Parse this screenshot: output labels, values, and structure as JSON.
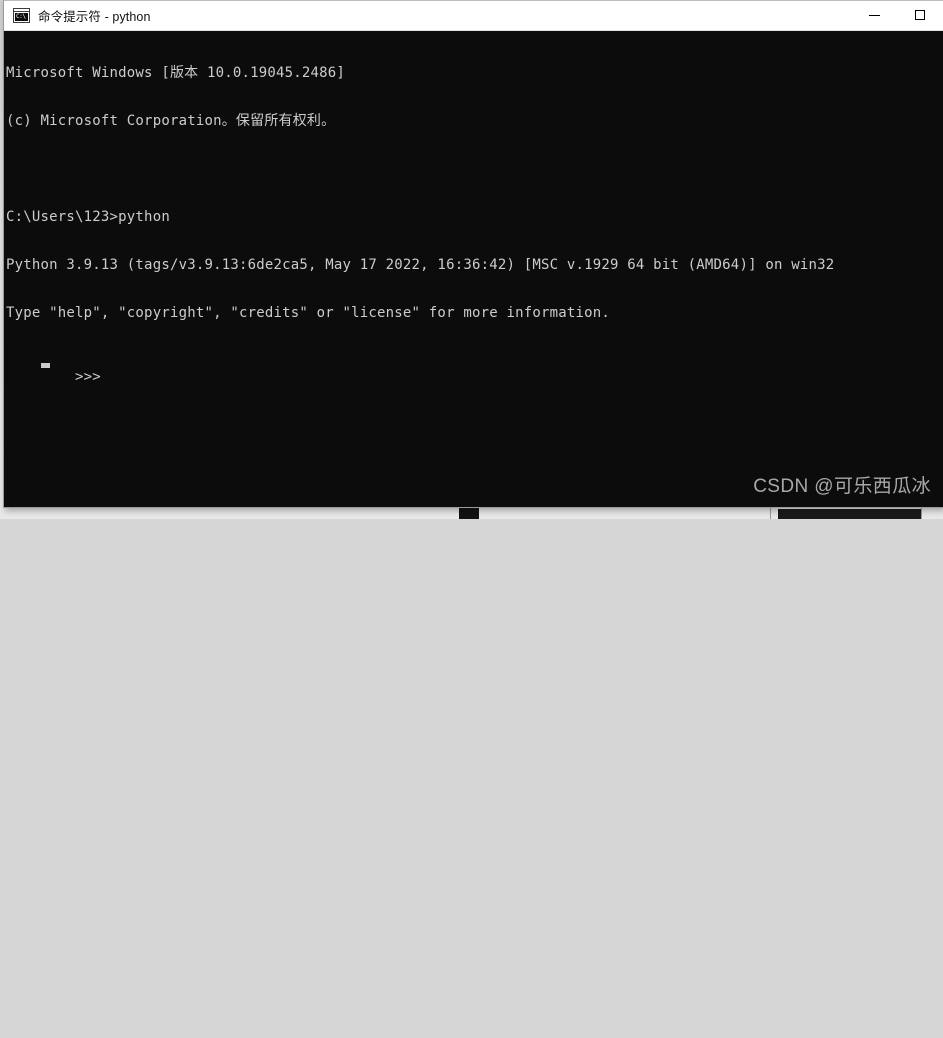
{
  "window": {
    "title": "命令提示符 - python",
    "icon_name": "cmd-prompt-icon",
    "icon_text": "C:\\",
    "background_color": "#0c0c0c",
    "titlebar_color": "#ffffff",
    "controls": {
      "minimize_label": "最小化",
      "maximize_label": "最大化"
    }
  },
  "console": {
    "foreground_color": "#cccccc",
    "lines": [
      "Microsoft Windows [版本 10.0.19045.2486]",
      "(c) Microsoft Corporation。保留所有权利。",
      "",
      "C:\\Users\\123>python",
      "Python 3.9.13 (tags/v3.9.13:6de2ca5, May 17 2022, 16:36:42) [MSC v.1929 64 bit (AMD64)] on win32",
      "Type \"help\", \"copyright\", \"credits\" or \"license\" for more information."
    ],
    "prompt": ">>>",
    "cursor": "block"
  },
  "watermark": {
    "text": "CSDN @可乐西瓜冰",
    "color": "#b6b6b6"
  },
  "desktop": {
    "background_color": "#dedede"
  }
}
